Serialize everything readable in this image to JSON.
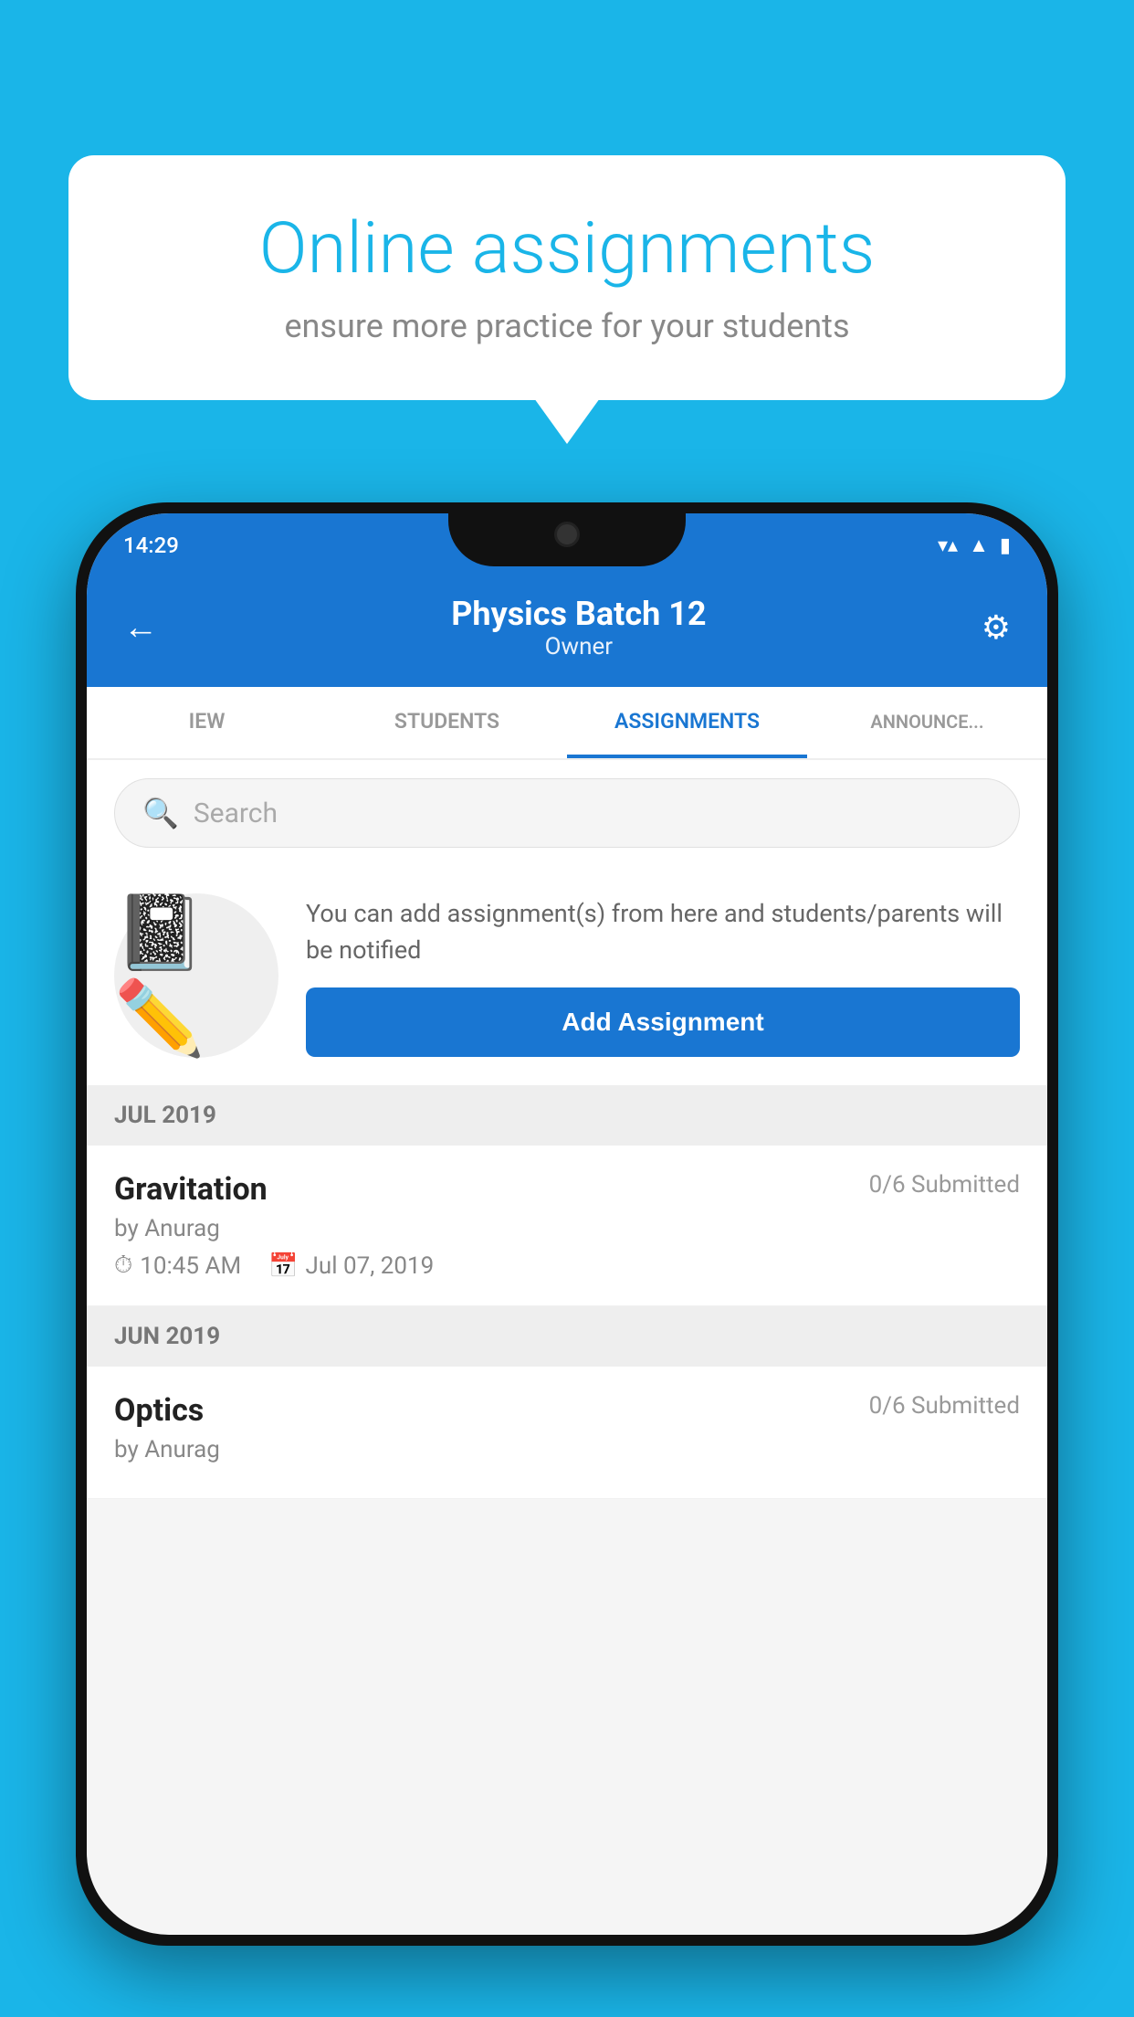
{
  "background_color": "#1ab5e8",
  "speech_bubble": {
    "title": "Online assignments",
    "subtitle": "ensure more practice for your students"
  },
  "phone": {
    "status_bar": {
      "time": "14:29",
      "wifi": "▼",
      "signal": "▲",
      "battery": "▮"
    },
    "header": {
      "back_label": "←",
      "batch_title": "Physics Batch 12",
      "batch_subtitle": "Owner",
      "settings_label": "⚙"
    },
    "tabs": [
      {
        "label": "IEW",
        "active": false
      },
      {
        "label": "STUDENTS",
        "active": false
      },
      {
        "label": "ASSIGNMENTS",
        "active": true
      },
      {
        "label": "ANNOUNCEMENTS",
        "active": false
      }
    ],
    "search": {
      "placeholder": "Search"
    },
    "promo": {
      "text": "You can add assignment(s) from here and students/parents will be notified",
      "button_label": "Add Assignment"
    },
    "sections": [
      {
        "header": "JUL 2019",
        "assignments": [
          {
            "name": "Gravitation",
            "submitted": "0/6 Submitted",
            "by": "by Anurag",
            "time": "10:45 AM",
            "date": "Jul 07, 2019"
          }
        ]
      },
      {
        "header": "JUN 2019",
        "assignments": [
          {
            "name": "Optics",
            "submitted": "0/6 Submitted",
            "by": "by Anurag",
            "time": "",
            "date": ""
          }
        ]
      }
    ]
  }
}
